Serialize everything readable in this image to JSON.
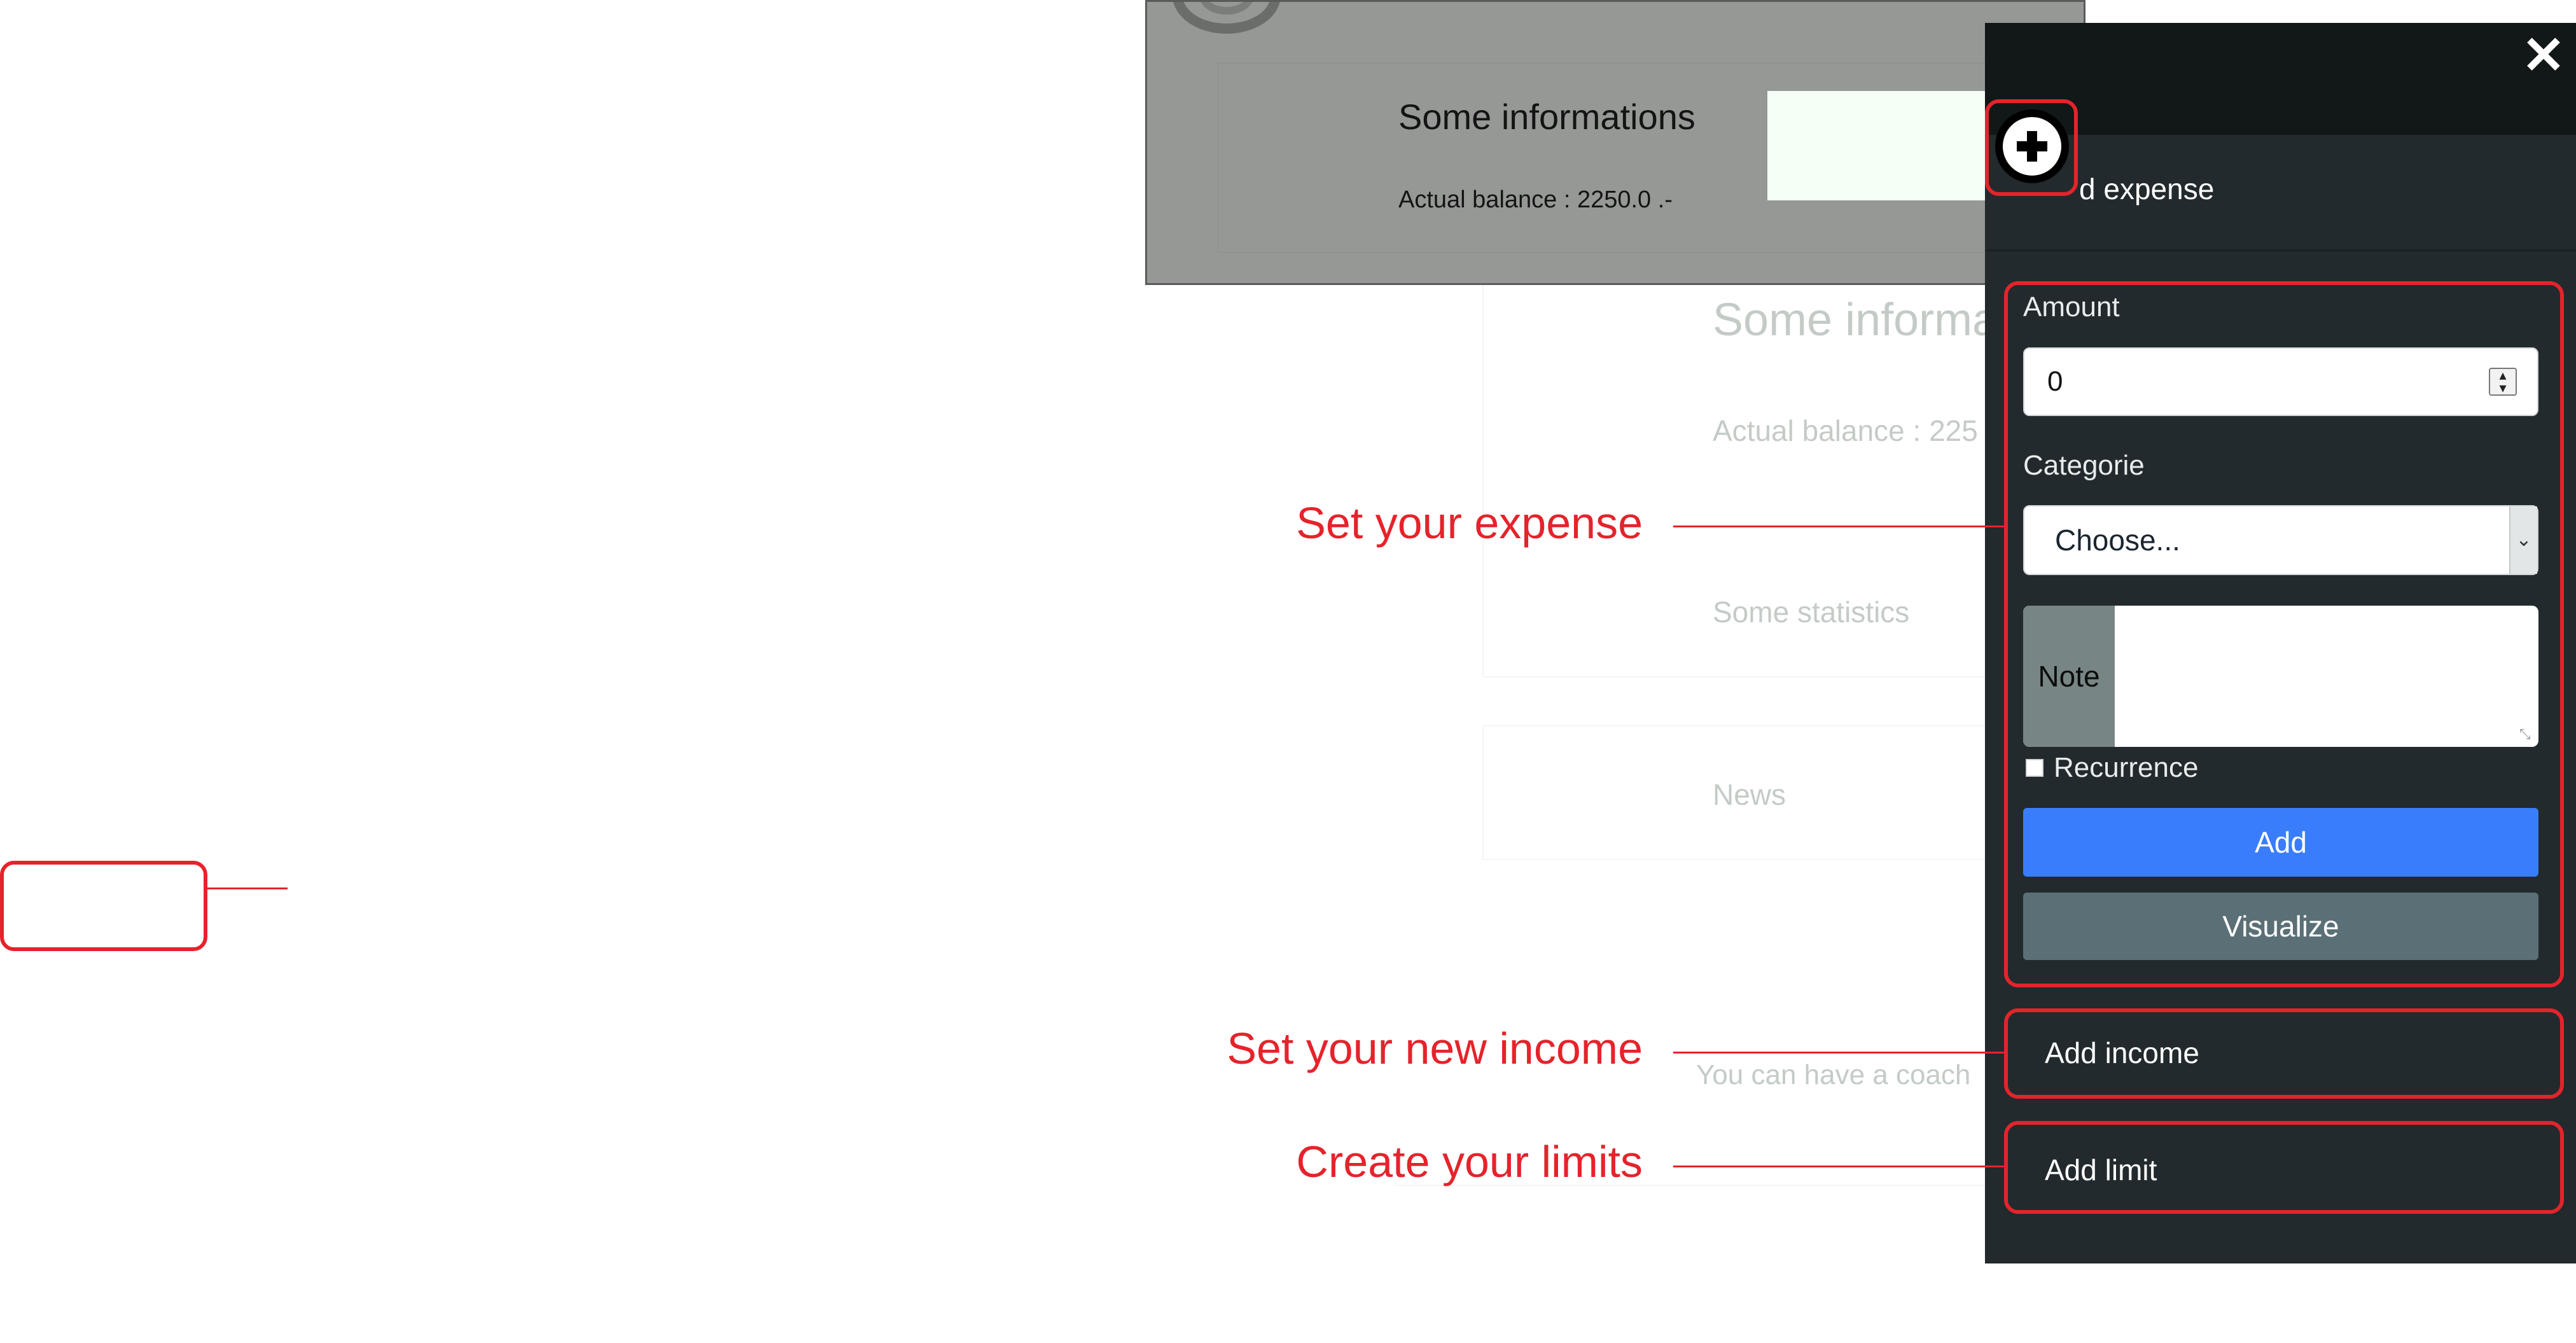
{
  "background_page": {
    "info_title": "Some informa",
    "balance_line": "Actual balance : 225",
    "stats_title": "Some statistics",
    "news_title": "News",
    "coach_text": "You can have a coach"
  },
  "inset": {
    "title": "Some informations",
    "balance_line": "Actual balance : 2250.0 .-"
  },
  "panel": {
    "add_expense_title": "d expense",
    "form": {
      "amount_label": "Amount",
      "amount_value": "0",
      "category_label": "Categorie",
      "category_selected": "Choose...",
      "note_label": "Note",
      "recurrence_label": "Recurrence",
      "recurrence_checked": false,
      "add_button": "Add",
      "visualize_button": "Visualize"
    },
    "add_income": "Add income",
    "add_limit": "Add limit"
  },
  "annotations": {
    "expense": "Set your expense",
    "income": "Set your new income",
    "limits": "Create your limits"
  },
  "colors": {
    "annotation_red": "#e5232b",
    "panel_bg": "#222a2d",
    "primary_button": "#3a7dfc",
    "secondary_button": "#5b6f76"
  }
}
